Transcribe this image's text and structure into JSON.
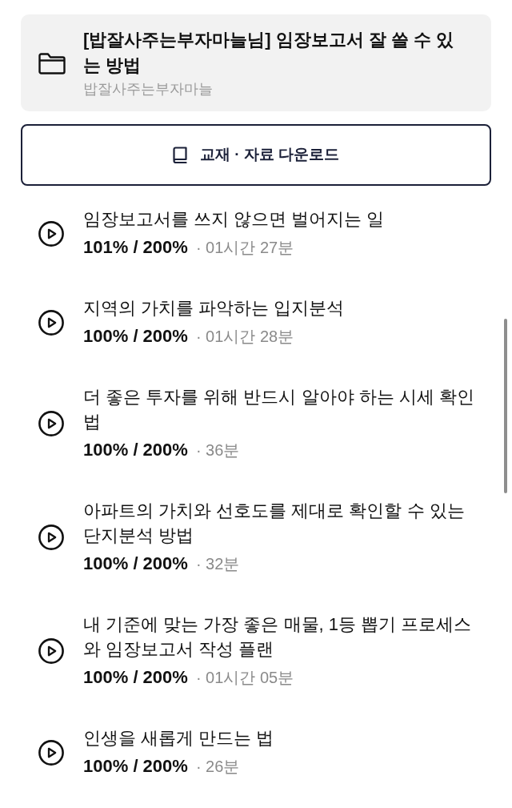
{
  "course": {
    "title": "[밥잘사주는부자마늘님] 임장보고서 잘 쓸 수 있는 방법",
    "author": "밥잘사주는부자마늘"
  },
  "download_button": {
    "label": "교재 · 자료 다운로드"
  },
  "lessons": [
    {
      "title": "임장보고서를 쓰지 않으면 벌어지는 일",
      "progress": "101% / 200%",
      "duration": "· 01시간 27분"
    },
    {
      "title": "지역의 가치를 파악하는 입지분석",
      "progress": "100% / 200%",
      "duration": "· 01시간 28분"
    },
    {
      "title": "더 좋은 투자를 위해 반드시 알아야 하는 시세 확인법",
      "progress": "100% / 200%",
      "duration": "· 36분"
    },
    {
      "title": "아파트의 가치와 선호도를 제대로 확인할 수 있는 단지분석 방법",
      "progress": "100% / 200%",
      "duration": "· 32분"
    },
    {
      "title": "내 기준에 맞는 가장 좋은 매물, 1등 뽑기 프로세스와 임장보고서 작성 플랜",
      "progress": "100% / 200%",
      "duration": "· 01시간 05분"
    },
    {
      "title": "인생을 새롭게 만드는 법",
      "progress": "100% / 200%",
      "duration": "· 26분"
    }
  ]
}
